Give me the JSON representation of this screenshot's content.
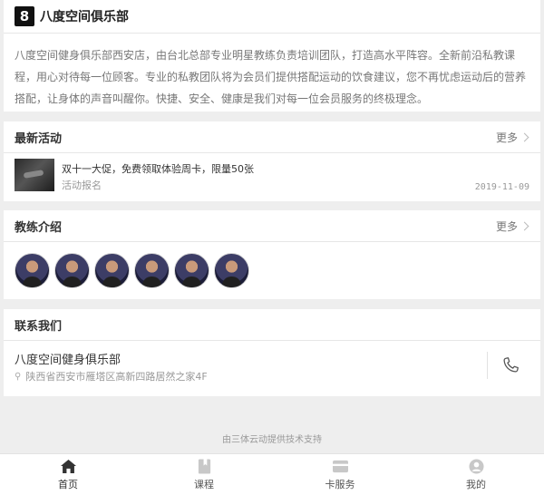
{
  "club": {
    "logo": "8",
    "name": "八度空间俱乐部",
    "intro": "八度空间健身俱乐部西安店，由台北总部专业明星教练负责培训团队，打造高水平阵容。全新前沿私教课程，用心对待每一位顾客。专业的私教团队将为会员们提供搭配运动的饮食建议，您不再忧虑运动后的营养搭配，让身体的声音叫醒你。快捷、安全、健康是我们对每一位会员服务的终极理念。"
  },
  "activity": {
    "title": "最新活动",
    "more": "更多",
    "item": {
      "title": "双十一大促，免费领取体验周卡，限量50张",
      "sub": "活动报名",
      "date": "2019-11-09"
    }
  },
  "coaches": {
    "title": "教练介绍",
    "more": "更多",
    "count": 6
  },
  "contact": {
    "title": "联系我们",
    "name": "八度空间健身俱乐部",
    "address": "陕西省西安市雁塔区高新四路居然之家4F"
  },
  "powered": "由三体云动提供技术支持",
  "tabs": [
    {
      "label": "首页",
      "icon": "home-icon",
      "active": true
    },
    {
      "label": "课程",
      "icon": "book-icon",
      "active": false
    },
    {
      "label": "卡服务",
      "icon": "card-icon",
      "active": false
    },
    {
      "label": "我的",
      "icon": "user-icon",
      "active": false
    }
  ],
  "colors": {
    "accent": "#333333",
    "icon_inactive": "#c8c8c8",
    "background": "#eeeeee"
  }
}
